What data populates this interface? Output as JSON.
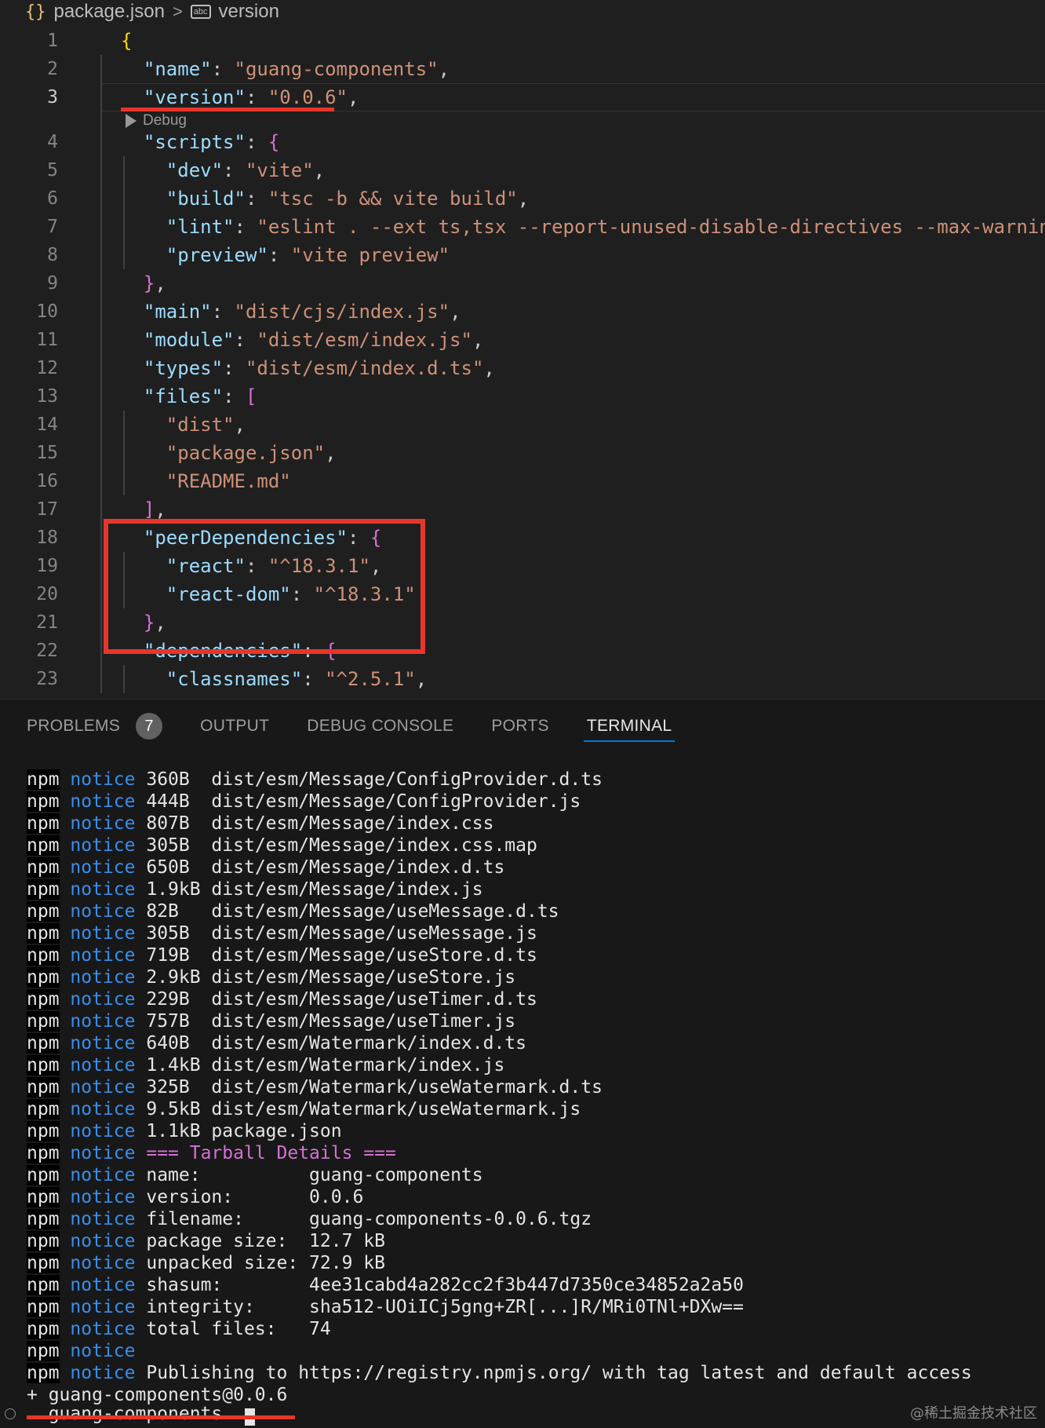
{
  "breadcrumb": {
    "braces_icon": "{}",
    "file": "package.json",
    "separator": ">",
    "string_icon": "abc",
    "item": "version"
  },
  "editor": {
    "codelens": "Debug",
    "lines": [
      {
        "n": "1",
        "segs": [
          [
            "{",
            "b0"
          ]
        ]
      },
      {
        "n": "2",
        "segs": [
          [
            "  ",
            "p"
          ],
          [
            "\"name\"",
            "k"
          ],
          [
            ": ",
            "p"
          ],
          [
            "\"guang-components\"",
            "s"
          ],
          [
            ",",
            "p"
          ]
        ]
      },
      {
        "n": "3",
        "segs": [
          [
            "  ",
            "p"
          ],
          [
            "\"version\"",
            "k"
          ],
          [
            ": ",
            "p"
          ],
          [
            "\"0.0.6\"",
            "s"
          ],
          [
            ",",
            "p"
          ]
        ]
      },
      {
        "n": "4",
        "segs": [
          [
            "  ",
            "p"
          ],
          [
            "\"scripts\"",
            "k"
          ],
          [
            ": ",
            "p"
          ],
          [
            "{",
            "b1"
          ]
        ]
      },
      {
        "n": "5",
        "segs": [
          [
            "    ",
            "p"
          ],
          [
            "\"dev\"",
            "k"
          ],
          [
            ": ",
            "p"
          ],
          [
            "\"vite\"",
            "s"
          ],
          [
            ",",
            "p"
          ]
        ]
      },
      {
        "n": "6",
        "segs": [
          [
            "    ",
            "p"
          ],
          [
            "\"build\"",
            "k"
          ],
          [
            ": ",
            "p"
          ],
          [
            "\"tsc -b && vite build\"",
            "s"
          ],
          [
            ",",
            "p"
          ]
        ]
      },
      {
        "n": "7",
        "segs": [
          [
            "    ",
            "p"
          ],
          [
            "\"lint\"",
            "k"
          ],
          [
            ": ",
            "p"
          ],
          [
            "\"eslint . --ext ts,tsx --report-unused-disable-directives --max-warnings",
            "s"
          ]
        ]
      },
      {
        "n": "8",
        "segs": [
          [
            "    ",
            "p"
          ],
          [
            "\"preview\"",
            "k"
          ],
          [
            ": ",
            "p"
          ],
          [
            "\"vite preview\"",
            "s"
          ]
        ]
      },
      {
        "n": "9",
        "segs": [
          [
            "  ",
            "p"
          ],
          [
            "}",
            "b1"
          ],
          [
            ",",
            "p"
          ]
        ]
      },
      {
        "n": "10",
        "segs": [
          [
            "  ",
            "p"
          ],
          [
            "\"main\"",
            "k"
          ],
          [
            ": ",
            "p"
          ],
          [
            "\"dist/cjs/index.js\"",
            "s"
          ],
          [
            ",",
            "p"
          ]
        ]
      },
      {
        "n": "11",
        "segs": [
          [
            "  ",
            "p"
          ],
          [
            "\"module\"",
            "k"
          ],
          [
            ": ",
            "p"
          ],
          [
            "\"dist/esm/index.js\"",
            "s"
          ],
          [
            ",",
            "p"
          ]
        ]
      },
      {
        "n": "12",
        "segs": [
          [
            "  ",
            "p"
          ],
          [
            "\"types\"",
            "k"
          ],
          [
            ": ",
            "p"
          ],
          [
            "\"dist/esm/index.d.ts\"",
            "s"
          ],
          [
            ",",
            "p"
          ]
        ]
      },
      {
        "n": "13",
        "segs": [
          [
            "  ",
            "p"
          ],
          [
            "\"files\"",
            "k"
          ],
          [
            ": ",
            "p"
          ],
          [
            "[",
            "b1"
          ]
        ]
      },
      {
        "n": "14",
        "segs": [
          [
            "    ",
            "p"
          ],
          [
            "\"dist\"",
            "s"
          ],
          [
            ",",
            "p"
          ]
        ]
      },
      {
        "n": "15",
        "segs": [
          [
            "    ",
            "p"
          ],
          [
            "\"package.json\"",
            "s"
          ],
          [
            ",",
            "p"
          ]
        ]
      },
      {
        "n": "16",
        "segs": [
          [
            "    ",
            "p"
          ],
          [
            "\"README.md\"",
            "s"
          ]
        ]
      },
      {
        "n": "17",
        "segs": [
          [
            "  ",
            "p"
          ],
          [
            "]",
            "b1"
          ],
          [
            ",",
            "p"
          ]
        ]
      },
      {
        "n": "18",
        "segs": [
          [
            "  ",
            "p"
          ],
          [
            "\"peerDependencies\"",
            "k"
          ],
          [
            ": ",
            "p"
          ],
          [
            "{",
            "b1"
          ]
        ]
      },
      {
        "n": "19",
        "segs": [
          [
            "    ",
            "p"
          ],
          [
            "\"react\"",
            "k"
          ],
          [
            ": ",
            "p"
          ],
          [
            "\"^18.3.1\"",
            "s"
          ],
          [
            ",",
            "p"
          ]
        ]
      },
      {
        "n": "20",
        "segs": [
          [
            "    ",
            "p"
          ],
          [
            "\"react-dom\"",
            "k"
          ],
          [
            ": ",
            "p"
          ],
          [
            "\"^18.3.1\"",
            "s"
          ]
        ]
      },
      {
        "n": "21",
        "segs": [
          [
            "  ",
            "p"
          ],
          [
            "}",
            "b1"
          ],
          [
            ",",
            "p"
          ]
        ]
      },
      {
        "n": "22",
        "segs": [
          [
            "  ",
            "p"
          ],
          [
            "\"dependencies\"",
            "k"
          ],
          [
            ": ",
            "p"
          ],
          [
            "{",
            "b1"
          ]
        ]
      },
      {
        "n": "23",
        "segs": [
          [
            "    ",
            "p"
          ],
          [
            "\"classnames\"",
            "k"
          ],
          [
            ": ",
            "p"
          ],
          [
            "\"^2.5.1\"",
            "s"
          ],
          [
            ",",
            "p"
          ]
        ]
      }
    ]
  },
  "panel": {
    "tabs": [
      {
        "label": "PROBLEMS",
        "badge": "7",
        "active": false
      },
      {
        "label": "OUTPUT",
        "active": false
      },
      {
        "label": "DEBUG CONSOLE",
        "active": false
      },
      {
        "label": "PORTS",
        "active": false
      },
      {
        "label": "TERMINAL",
        "active": true
      }
    ]
  },
  "terminal": {
    "npm": "npm",
    "notice": "notice",
    "lines": [
      {
        "rest": "360B  dist/esm/Message/ConfigProvider.d.ts"
      },
      {
        "rest": "444B  dist/esm/Message/ConfigProvider.js"
      },
      {
        "rest": "807B  dist/esm/Message/index.css"
      },
      {
        "rest": "305B  dist/esm/Message/index.css.map"
      },
      {
        "rest": "650B  dist/esm/Message/index.d.ts"
      },
      {
        "rest": "1.9kB dist/esm/Message/index.js"
      },
      {
        "rest": "82B   dist/esm/Message/useMessage.d.ts"
      },
      {
        "rest": "305B  dist/esm/Message/useMessage.js"
      },
      {
        "rest": "719B  dist/esm/Message/useStore.d.ts"
      },
      {
        "rest": "2.9kB dist/esm/Message/useStore.js"
      },
      {
        "rest": "229B  dist/esm/Message/useTimer.d.ts"
      },
      {
        "rest": "757B  dist/esm/Message/useTimer.js"
      },
      {
        "rest": "640B  dist/esm/Watermark/index.d.ts"
      },
      {
        "rest": "1.4kB dist/esm/Watermark/index.js"
      },
      {
        "rest": "325B  dist/esm/Watermark/useWatermark.d.ts"
      },
      {
        "rest": "9.5kB dist/esm/Watermark/useWatermark.js"
      },
      {
        "rest": "1.1kB package.json"
      },
      {
        "rest": "=== Tarball Details ===",
        "style": "tb"
      },
      {
        "rest": "name:          guang-components"
      },
      {
        "rest": "version:       0.0.6"
      },
      {
        "rest": "filename:      guang-components-0.0.6.tgz"
      },
      {
        "rest": "package size:  12.7 kB"
      },
      {
        "rest": "unpacked size: 72.9 kB"
      },
      {
        "rest": "shasum:        4ee31cabd4a282cc2f3b447d7350ce34852a2a50"
      },
      {
        "rest": "integrity:     sha512-UOiICj5gng+ZR[...]R/MRi0TNl+DXw=="
      },
      {
        "rest": "total files:   74"
      },
      {
        "rest": ""
      },
      {
        "rest": "Publishing to https://registry.npmjs.org/ with tag latest and default access"
      }
    ],
    "result": "+ guang-components@0.0.6",
    "prompt_line": "  guang-components "
  },
  "watermark": "@稀土掘金技术社区",
  "colors": {
    "annotation_red": "#e8352b",
    "key": "#9cdcfe",
    "string": "#ce9178",
    "notice": "#3b8eea",
    "tarball": "#d670d6"
  }
}
